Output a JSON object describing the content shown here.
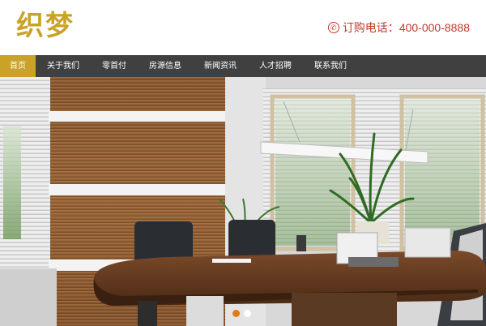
{
  "site": {
    "logo_text": "织梦",
    "hotline_label": "订购电话：",
    "hotline_number": "400-000-8888"
  },
  "nav": {
    "items": [
      {
        "label": "首页",
        "active": true
      },
      {
        "label": "关于我们"
      },
      {
        "label": "零首付"
      },
      {
        "label": "房源信息"
      },
      {
        "label": "新闻资讯"
      },
      {
        "label": "人才招聘"
      },
      {
        "label": "联系我们"
      }
    ]
  },
  "banner": {
    "slide_count": 2,
    "active_slide": 1
  },
  "colors": {
    "brand_gold": "#c9a227",
    "nav_bg": "#404040",
    "hotline_red": "#c0392b",
    "dot_active": "#e07b1a"
  }
}
